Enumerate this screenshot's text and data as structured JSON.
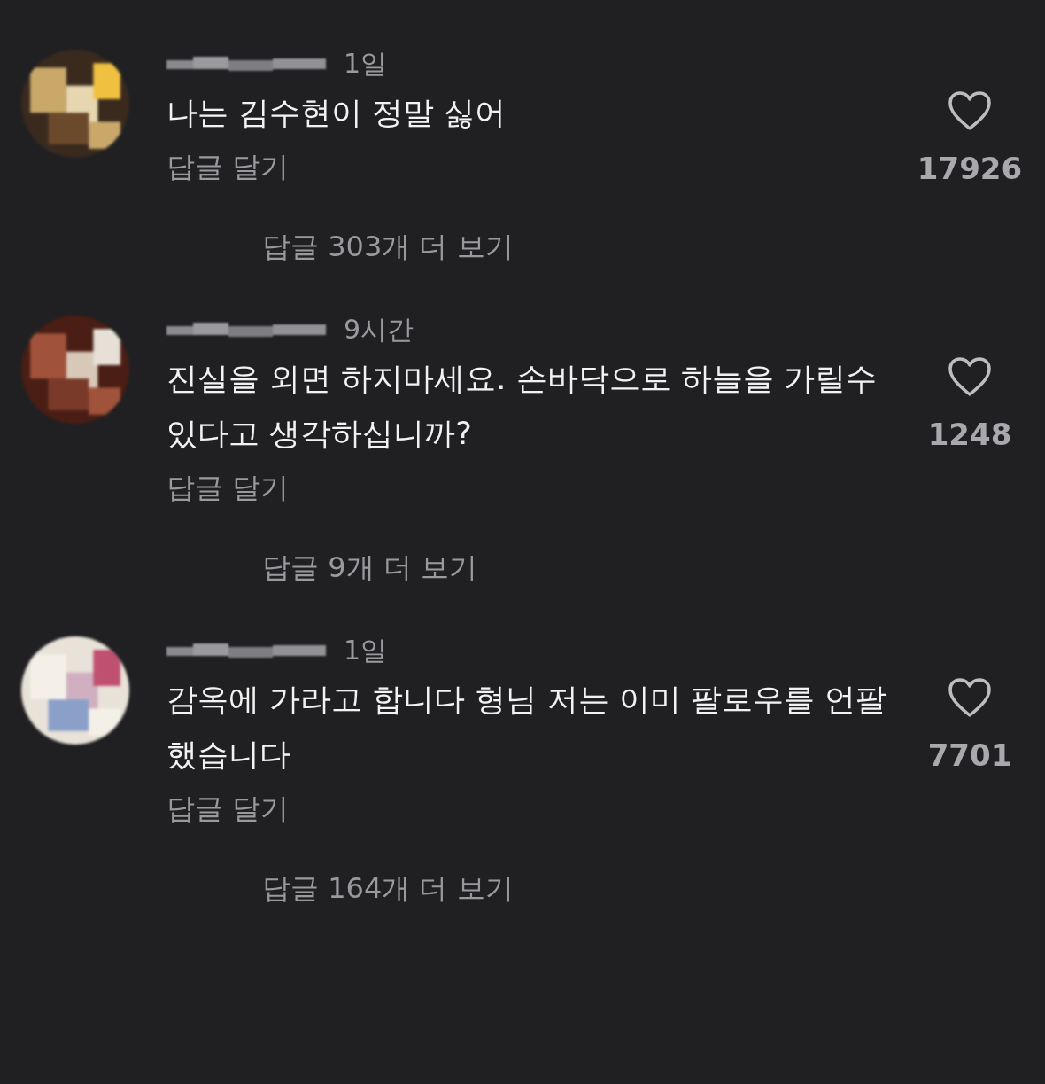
{
  "comments": [
    {
      "time": "1일",
      "text": "나는 김수현이 정말 싫어",
      "reply_button": "답글 달기",
      "liked": false,
      "likes": "17926",
      "view_replies": "답글 303개 더 보기"
    },
    {
      "time": "9시간",
      "text": "진실을 외면 하지마세요. 손바닥으로 하늘을 가릴수 있다고 생각하십니까?",
      "reply_button": "답글 달기",
      "liked": false,
      "likes": "1248",
      "view_replies": "답글 9개 더 보기"
    },
    {
      "time": "1일",
      "text": "감옥에 가라고 합니다 형님 저는 이미 팔로우를 언팔했습니다",
      "reply_button": "답글 달기",
      "liked": false,
      "likes": "7701",
      "view_replies": "답글 164개 더 보기"
    }
  ]
}
